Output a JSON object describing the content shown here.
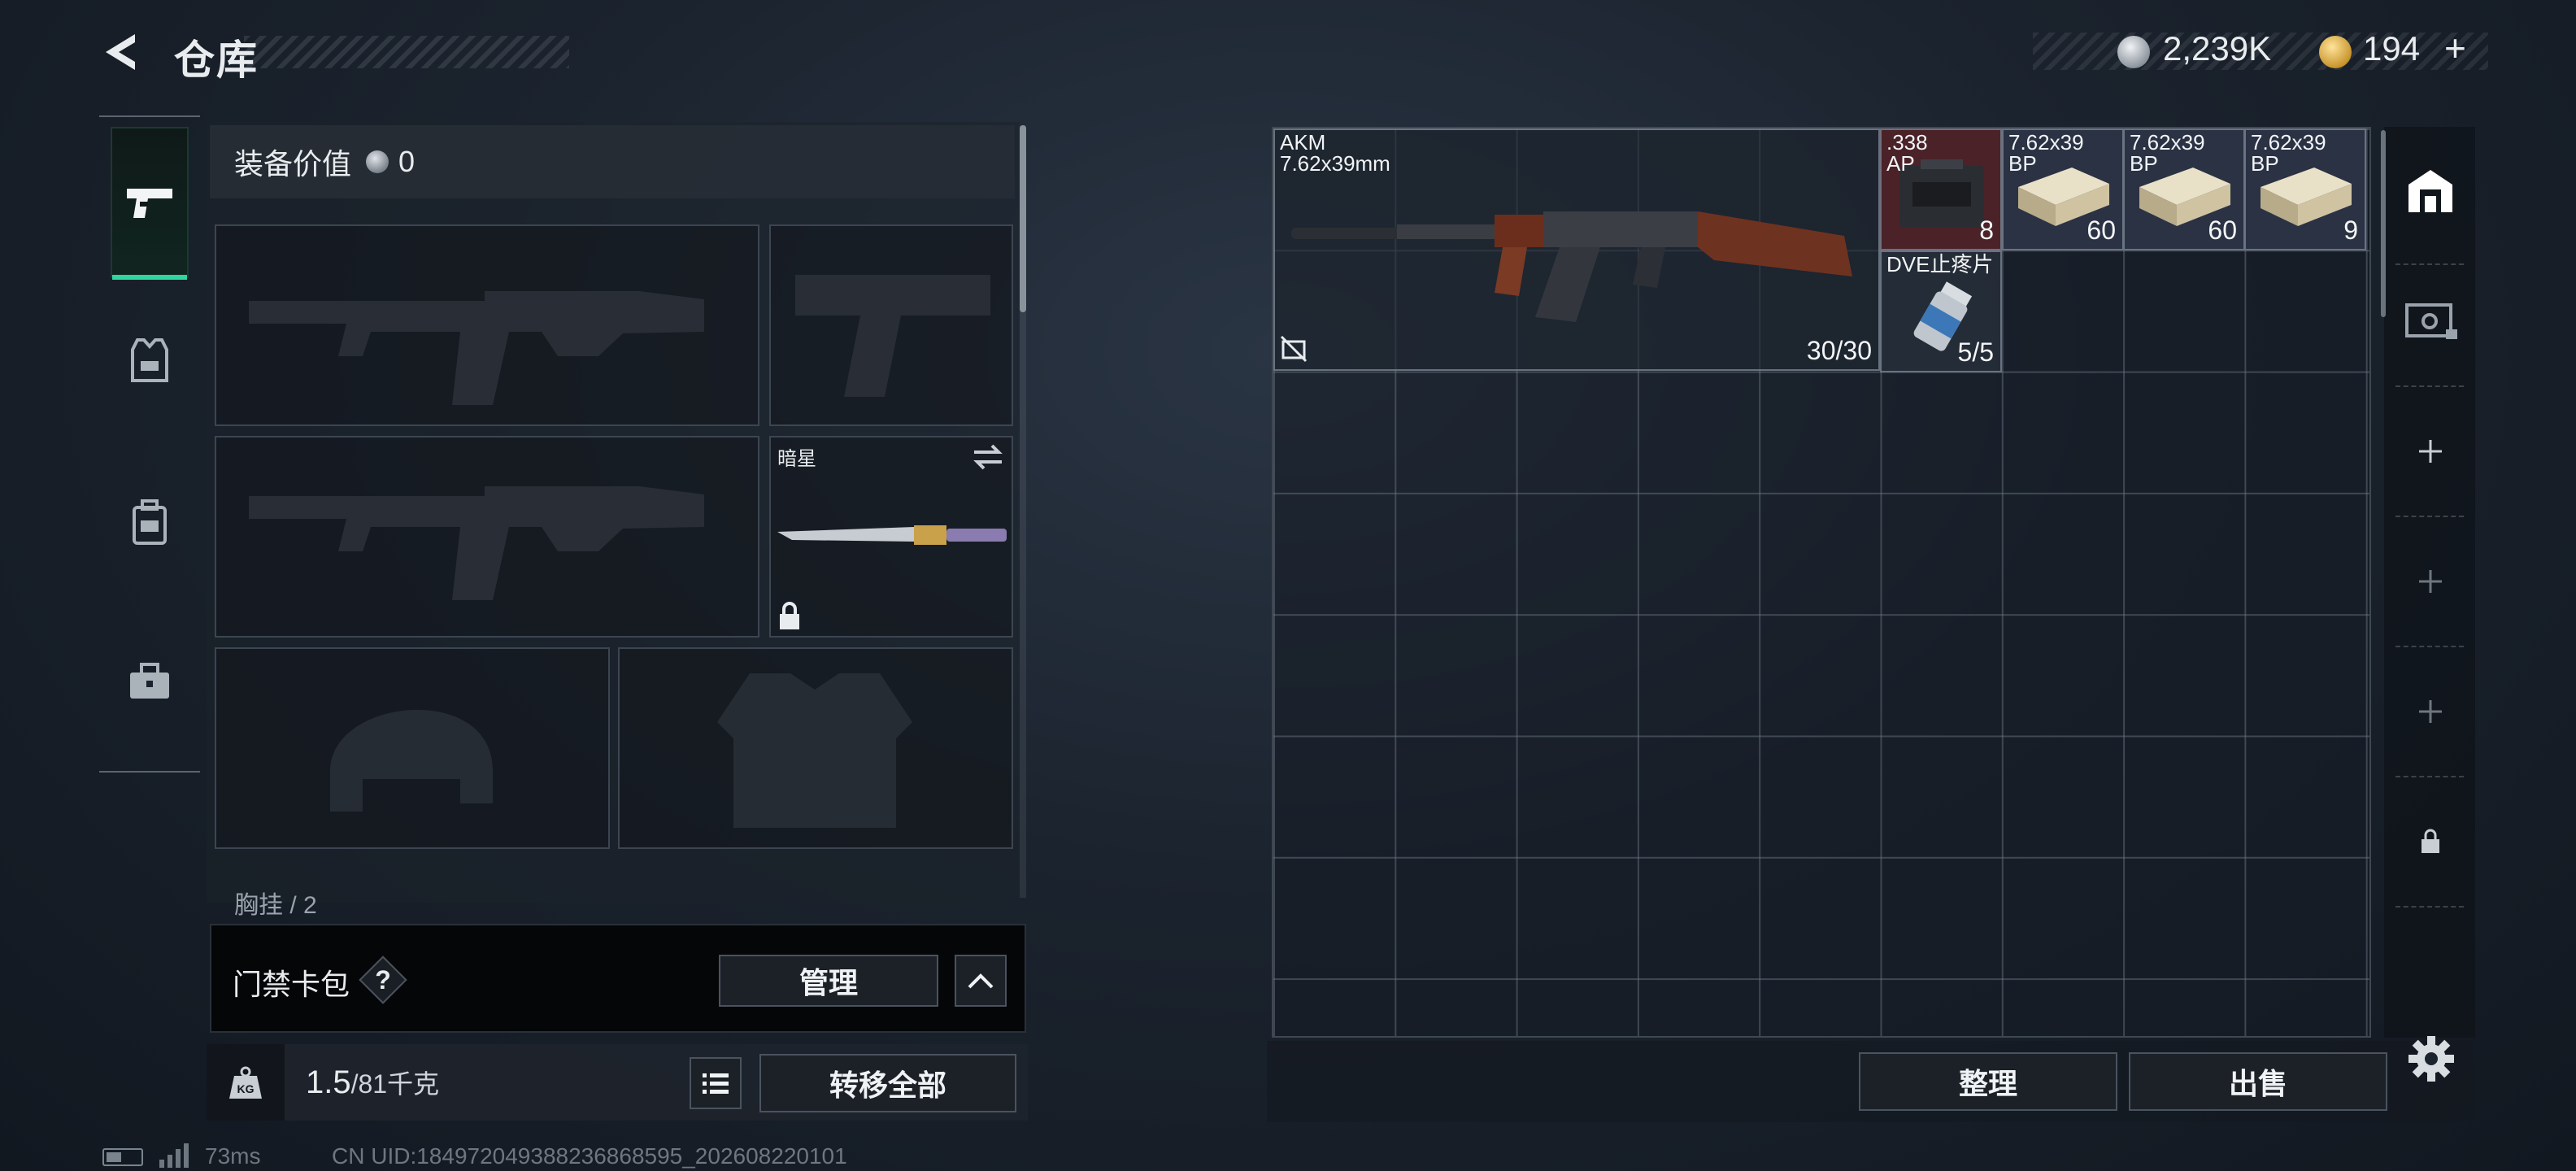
{
  "header": {
    "title": "仓库",
    "silver_amount": "2,239K",
    "gold_amount": "194",
    "gold_plus": "+"
  },
  "sidebar_tabs": [
    {
      "name": "weapons",
      "icon": "pistol-icon",
      "active": true
    },
    {
      "name": "gear",
      "icon": "vest-icon",
      "active": false
    },
    {
      "name": "backpack",
      "icon": "backpack-icon",
      "active": false
    },
    {
      "name": "toolbox",
      "icon": "toolbox-icon",
      "active": false
    }
  ],
  "equipment": {
    "value_label": "装备价值",
    "value_amount": "0",
    "melee_name": "暗星",
    "cutoff_label": "胸挂 / 2"
  },
  "keycard": {
    "label": "门禁卡包",
    "help": "?",
    "manage_label": "管理"
  },
  "weight": {
    "current": "1.5",
    "max": "/81千克",
    "transfer_all_label": "转移全部"
  },
  "storage": {
    "items": [
      {
        "id": "akm",
        "name_line1": "AKM",
        "name_line2": "7.62x39mm",
        "count": "30/30"
      },
      {
        "id": "ammo-338",
        "name_line1": ".338",
        "name_line2": "AP",
        "count": "8"
      },
      {
        "id": "ammo-bp-1",
        "name_line1": "7.62x39",
        "name_line2": "BP",
        "count": "60"
      },
      {
        "id": "ammo-bp-2",
        "name_line1": "7.62x39",
        "name_line2": "BP",
        "count": "60"
      },
      {
        "id": "ammo-bp-3",
        "name_line1": "7.62x39",
        "name_line2": "BP",
        "count": "9"
      },
      {
        "id": "dve",
        "name_line1": "DVE止疼片",
        "name_line2": "",
        "count": "5/5"
      }
    ],
    "sort_label": "整理",
    "sell_label": "出售"
  },
  "status": {
    "latency": "73ms",
    "uid": "CN UID:18497204938823686859​5_202608220101"
  },
  "colors": {
    "accent": "#2fd6a0",
    "ammo_338_bg": "#4a2228",
    "ammo_bp_bg": "#2a3244"
  }
}
